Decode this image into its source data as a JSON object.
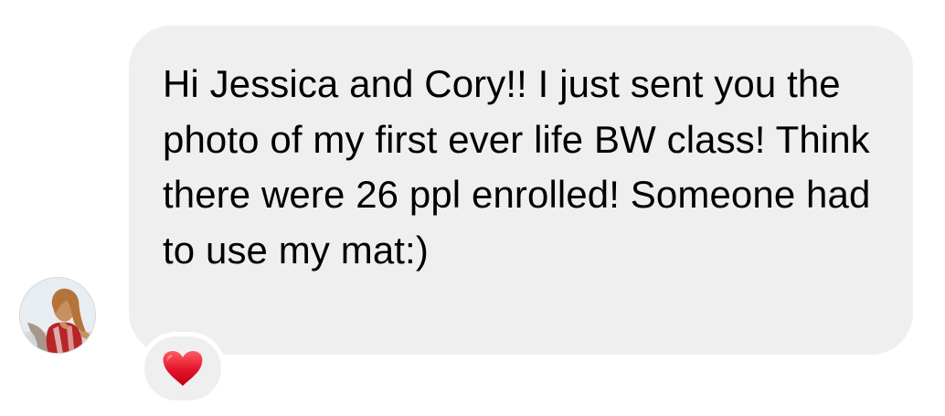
{
  "message": {
    "text": "Hi Jessica and Cory!! I just sent you the photo of my first ever life BW class! Think there were 26 ppl enrolled! Someone had to use my mat:)"
  },
  "reaction": {
    "icon": "red-heart-icon"
  },
  "colors": {
    "bubble_background": "#efefef",
    "text": "#000000",
    "reaction_heart": "#e0112b"
  }
}
